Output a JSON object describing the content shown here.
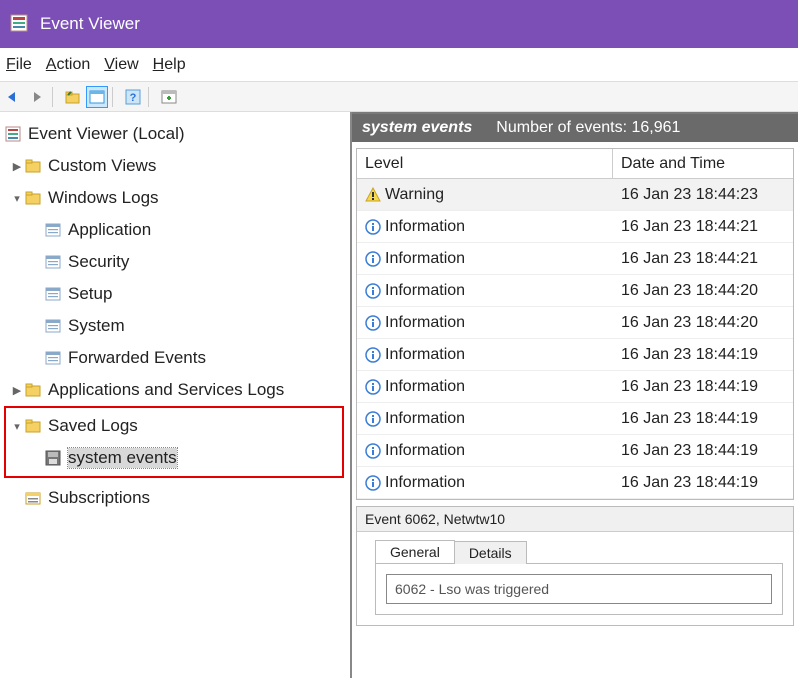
{
  "window": {
    "title": "Event Viewer"
  },
  "menubar": {
    "items": [
      "File",
      "Action",
      "View",
      "Help"
    ]
  },
  "tree": {
    "root": "Event Viewer (Local)",
    "custom_views": "Custom Views",
    "windows_logs": {
      "label": "Windows Logs",
      "children": [
        "Application",
        "Security",
        "Setup",
        "System",
        "Forwarded Events"
      ]
    },
    "apps_services": "Applications and Services Logs",
    "saved_logs": {
      "label": "Saved Logs",
      "children": [
        "system events"
      ]
    },
    "subscriptions": "Subscriptions"
  },
  "log_header": {
    "name": "system events",
    "count_label": "Number of events: 16,961"
  },
  "columns": {
    "level": "Level",
    "date": "Date and Time"
  },
  "events": [
    {
      "level": "Warning",
      "date": "16 Jan 23 18:44:23"
    },
    {
      "level": "Information",
      "date": "16 Jan 23 18:44:21"
    },
    {
      "level": "Information",
      "date": "16 Jan 23 18:44:21"
    },
    {
      "level": "Information",
      "date": "16 Jan 23 18:44:20"
    },
    {
      "level": "Information",
      "date": "16 Jan 23 18:44:20"
    },
    {
      "level": "Information",
      "date": "16 Jan 23 18:44:19"
    },
    {
      "level": "Information",
      "date": "16 Jan 23 18:44:19"
    },
    {
      "level": "Information",
      "date": "16 Jan 23 18:44:19"
    },
    {
      "level": "Information",
      "date": "16 Jan 23 18:44:19"
    },
    {
      "level": "Information",
      "date": "16 Jan 23 18:44:19"
    }
  ],
  "detail": {
    "title": "Event 6062, Netwtw10",
    "tabs": [
      "General",
      "Details"
    ],
    "message": "6062 - Lso was triggered"
  }
}
